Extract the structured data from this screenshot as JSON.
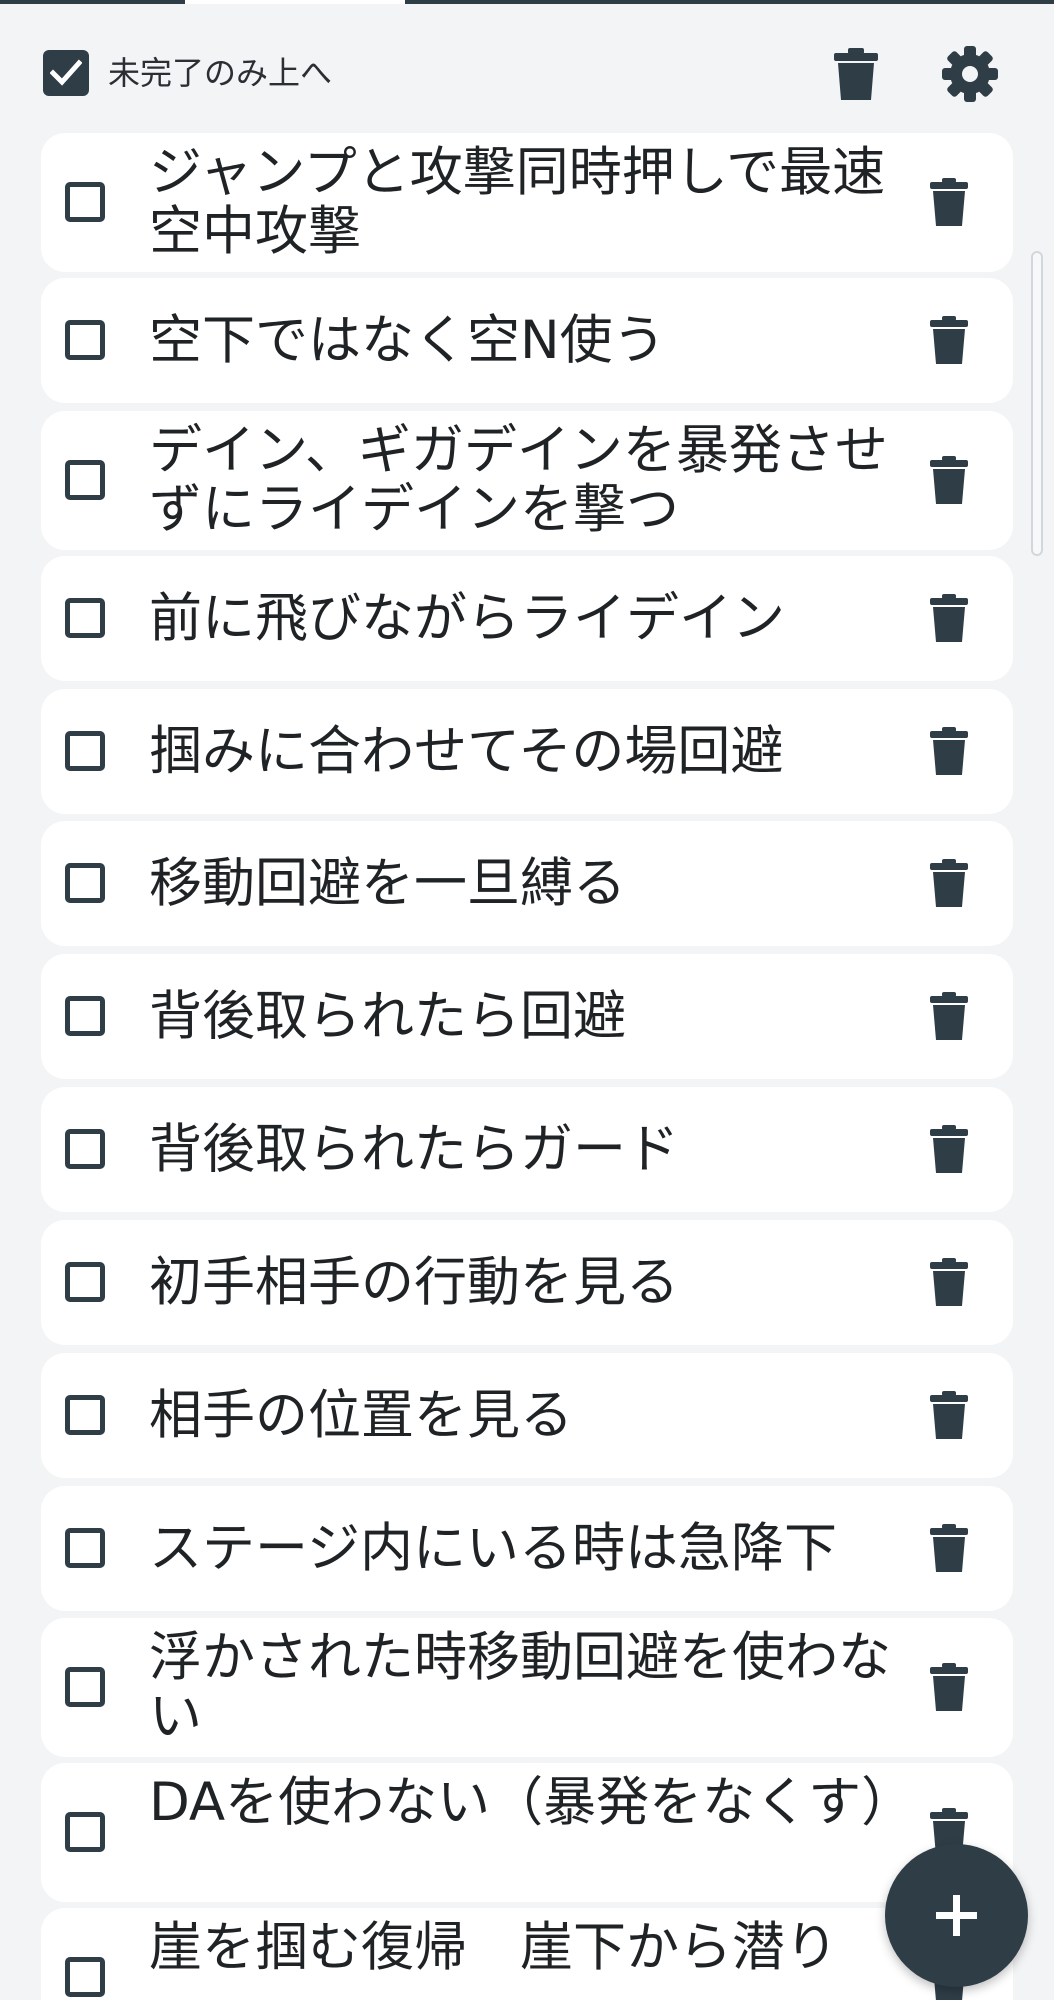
{
  "header": {
    "incomplete_first_label": "未完了のみ上へ",
    "incomplete_first_checked": true
  },
  "tasks": [
    {
      "text": "ジャンプと攻撃同時押しで最速空中攻撃",
      "done": false
    },
    {
      "text": "空下ではなく空N使う",
      "done": false
    },
    {
      "text": "デイン、ギガデインを暴発させずにライデインを撃つ",
      "done": false
    },
    {
      "text": "前に飛びながらライデイン",
      "done": false
    },
    {
      "text": "掴みに合わせてその場回避",
      "done": false
    },
    {
      "text": "移動回避を一旦縛る",
      "done": false
    },
    {
      "text": "背後取られたら回避",
      "done": false
    },
    {
      "text": "背後取られたらガード",
      "done": false
    },
    {
      "text": "初手相手の行動を見る",
      "done": false
    },
    {
      "text": "相手の位置を見る",
      "done": false
    },
    {
      "text": "ステージ内にいる時は急降下",
      "done": false
    },
    {
      "text": "浮かされた時移動回避を使わない",
      "done": false
    },
    {
      "text": "DAを使わない（暴発をなくす）",
      "done": false
    },
    {
      "text": "崖を掴む復帰　崖下から潜り",
      "done": false
    }
  ],
  "icons": {
    "header_check": "checkmark-icon",
    "header_delete": "trash-icon",
    "settings": "gear-icon",
    "row_delete": "trash-icon",
    "add": "plus-icon"
  },
  "colors": {
    "primary": "#2f3d47",
    "background": "#f3f4f6",
    "card": "#ffffff",
    "text": "#1f2326"
  }
}
